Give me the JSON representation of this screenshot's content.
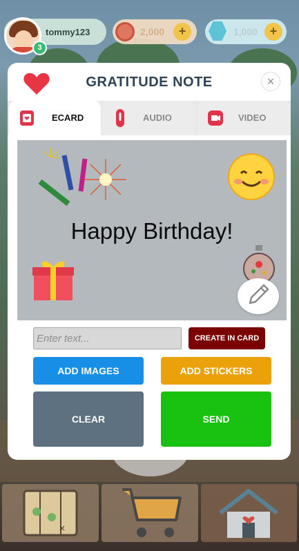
{
  "hud": {
    "username": "tommy123",
    "level": "3",
    "coins": "2,000",
    "gems": "1,000",
    "add_coins_label": "+",
    "add_gems_label": "+"
  },
  "modal": {
    "title": "GRATITUDE NOTE",
    "close_label": "×",
    "tabs": [
      {
        "label": "ECARD",
        "active": true
      },
      {
        "label": "AUDIO",
        "active": false
      },
      {
        "label": "VIDEO",
        "active": false
      }
    ],
    "card": {
      "message": "Happy Birthday!",
      "stickers": [
        "fireworks-icon",
        "smiley-face-icon",
        "gift-box-icon",
        "ornament-icon"
      ]
    },
    "text_input": {
      "placeholder": "Enter text...",
      "value": ""
    },
    "buttons": {
      "create_in_card": "CREATE IN CARD",
      "add_images": "ADD IMAGES",
      "add_stickers": "ADD STICKERS",
      "clear": "CLEAR",
      "send": "SEND"
    }
  },
  "bottom_nav": [
    "map-icon",
    "shopping-cart-icon",
    "home-icon"
  ],
  "colors": {
    "title_text": "#2f4256",
    "create_button": "#7a0006",
    "add_images_button": "#178fe6",
    "add_stickers_button": "#eaa10a",
    "clear_button": "#5e7180",
    "send_button": "#19c210",
    "tab_icon_red": "#e0344b"
  }
}
